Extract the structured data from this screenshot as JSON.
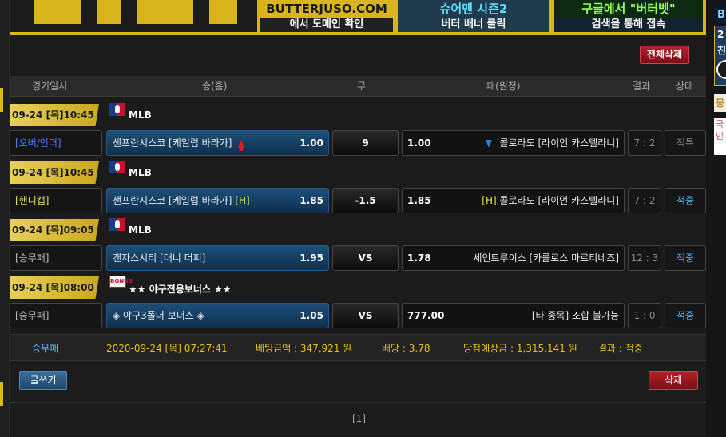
{
  "banner": {
    "items": [
      {
        "line1": "BUTTERJUSO.COM",
        "line2": "에서 도메인 확인"
      },
      {
        "line1": "슈어맨 시즌2",
        "line2": "버터 배너 클릭"
      },
      {
        "line1": "구글에서 \"버터벳\"",
        "line2": "검색을 통해 접속"
      }
    ]
  },
  "right_ads": {
    "box1": "B",
    "box2_line1": "2",
    "box2_line2": "친",
    "box3": "몽",
    "box4": "국인"
  },
  "buttons": {
    "delete_all": "전체삭제",
    "write": "글쓰기",
    "delete": "삭제"
  },
  "table_header": {
    "date": "경기일시",
    "home": "승(홈)",
    "draw": "무",
    "away": "패(원정)",
    "result": "결과",
    "state": "상태"
  },
  "games": [
    {
      "date": "09-24 [목]10:45",
      "league": "MLB",
      "bet_type": "[오버/언더]",
      "home_team": "샌프란시스코 [케일럽 바라가]",
      "home_odds": "1.00",
      "draw": "9",
      "away_odds": "1.00",
      "away_team": "콜로라도 [라이언 카스텔라니]",
      "score": "7 : 2",
      "state": "적특"
    },
    {
      "date": "09-24 [목]10:45",
      "league": "MLB",
      "bet_type": "[핸디캡]",
      "home_team": "샌프란시스코 [케일럽 바라가]",
      "home_marker": "[H]",
      "home_odds": "1.85",
      "draw": "-1.5",
      "away_odds": "1.85",
      "away_marker": "[H]",
      "away_team": "콜로라도 [라이언 카스텔라니]",
      "score": "7 : 2",
      "state": "적중"
    },
    {
      "date": "09-24 [목]09:05",
      "league": "MLB",
      "bet_type": "[승무패]",
      "home_team": "캔자스시티 [대니 더피]",
      "home_odds": "1.95",
      "draw": "VS",
      "away_odds": "1.78",
      "away_team": "세인트루이스 [카를로스 마르티네즈]",
      "score": "12 : 3",
      "state": "적중"
    },
    {
      "date": "09-24 [목]08:00",
      "league": "★★ 야구전용보너스 ★★",
      "league_icon_text": "BONUS",
      "bet_type": "[승무패]",
      "home_team": "◈ 야구3폴더 보너스 ◈",
      "home_odds": "1.05",
      "draw": "VS",
      "away_odds": "777.00",
      "away_team": "[타 종목] 조합 불가능",
      "score": "1 : 0",
      "state": "적중"
    }
  ],
  "summary": {
    "type": "승무패",
    "datetime": "2020-09-24 [목] 07:27:41",
    "bet_amount": "베팅금액 : 347,921 원",
    "odds": "배당 : 3.78",
    "expected": "당첨예상금 : 1,315,141 원",
    "result": "결과 : 적중"
  },
  "pager": "[1]",
  "colors": {
    "accent_gold": "#d8b51c",
    "win_blue": "#4db8ff",
    "red_button": "#a3161f"
  }
}
